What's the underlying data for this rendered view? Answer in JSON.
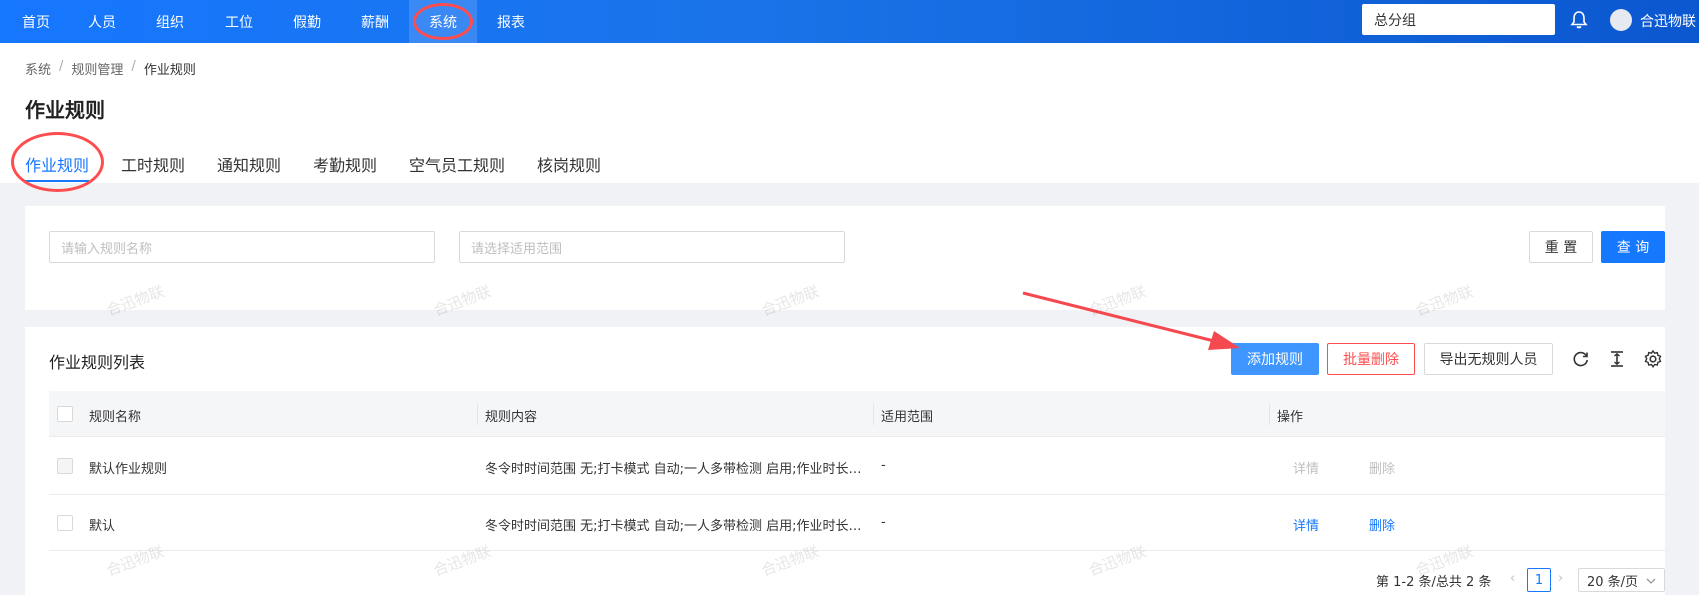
{
  "topnav": {
    "items": [
      "首页",
      "人员",
      "组织",
      "工位",
      "假勤",
      "薪酬",
      "系统",
      "报表"
    ],
    "active_index": 6,
    "org_select": "总分组",
    "user_name": "合迅物联"
  },
  "breadcrumb": [
    "系统",
    "规则管理",
    "作业规则"
  ],
  "page_title": "作业规则",
  "tabs": [
    "作业规则",
    "工时规则",
    "通知规则",
    "考勤规则",
    "空气员工规则",
    "核岗规则"
  ],
  "filters": {
    "name_placeholder": "请输入规则名称",
    "scope_placeholder": "请选择适用范围",
    "reset_label": "重 置",
    "query_label": "查 询"
  },
  "list": {
    "title": "作业规则列表",
    "add_label": "添加规则",
    "batch_delete_label": "批量删除",
    "export_label": "导出无规则人员",
    "columns": [
      "规则名称",
      "规则内容",
      "适用范围",
      "操作"
    ],
    "rows": [
      {
        "name": "默认作业规则",
        "content": "冬令时时间范围 无;打卡模式 自动;一人多带检测 启用;作业时长检测 启用",
        "scope": "-",
        "detail": "详情",
        "delete": "删除",
        "disabled": true
      },
      {
        "name": "默认",
        "content": "冬令时时间范围 无;打卡模式 自动;一人多带检测 启用;作业时长检测 启用",
        "scope": "-",
        "detail": "详情",
        "delete": "删除",
        "disabled": false
      }
    ]
  },
  "pagination": {
    "summary": "第 1-2 条/总共 2 条",
    "current_page": "1",
    "page_size": "20 条/页"
  },
  "watermark": "合迅物联",
  "colors": {
    "primary": "#1677ff",
    "danger": "#ff4d4f",
    "annotation": "#f5484f"
  },
  "icons": [
    "bell-icon",
    "refresh-icon",
    "column-height-icon",
    "settings-icon",
    "chevron-down-icon"
  ]
}
